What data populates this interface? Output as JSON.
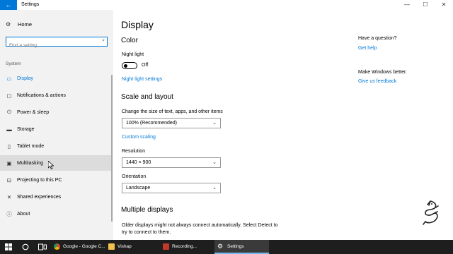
{
  "window": {
    "title": "Settings",
    "back_glyph": "←",
    "minimize_glyph": "—",
    "maximize_glyph": "☐",
    "close_glyph": "✕"
  },
  "sidebar": {
    "home_label": "Home",
    "search_placeholder": "Find a setting",
    "section_label": "System",
    "items": [
      {
        "label": "Display",
        "icon": "monitor-icon",
        "active": true
      },
      {
        "label": "Notifications & actions",
        "icon": "notifications-icon"
      },
      {
        "label": "Power & sleep",
        "icon": "power-icon"
      },
      {
        "label": "Storage",
        "icon": "storage-icon"
      },
      {
        "label": "Tablet mode",
        "icon": "tablet-icon"
      },
      {
        "label": "Multitasking",
        "icon": "multitasking-icon",
        "hover": true
      },
      {
        "label": "Projecting to this PC",
        "icon": "projecting-icon"
      },
      {
        "label": "Shared experiences",
        "icon": "shared-icon"
      },
      {
        "label": "About",
        "icon": "info-icon"
      }
    ]
  },
  "main": {
    "title": "Display",
    "color_heading": "Color",
    "night_light_label": "Night light",
    "night_light_state": "Off",
    "night_light_settings_link": "Night light settings",
    "scale_heading": "Scale and layout",
    "scale_label": "Change the size of text, apps, and other items",
    "scale_value": "100% (Recommended)",
    "custom_scaling_link": "Custom scaling",
    "resolution_label": "Resolution",
    "resolution_value": "1440 × 900",
    "orientation_label": "Orientation",
    "orientation_value": "Landscape",
    "multiple_heading": "Multiple displays",
    "multiple_text": "Older displays might not always connect automatically. Select Detect to try to connect to them."
  },
  "aside": {
    "question_heading": "Have a question?",
    "help_link": "Get help",
    "feedback_heading": "Make Windows better.",
    "feedback_link": "Give us feedback"
  },
  "taskbar": {
    "apps": [
      {
        "label": "Google - Google C...",
        "color": "#e8453c"
      },
      {
        "label": "Vishap",
        "color": "#f4c24c"
      },
      {
        "label": "Recording...",
        "color": "#c0392b"
      },
      {
        "label": "Settings",
        "color": "#ffffff",
        "active": true
      }
    ]
  },
  "colors": {
    "accent": "#0078d7",
    "sidebar_bg": "#f2f2f2",
    "taskbar_bg": "#1e1e1e"
  }
}
